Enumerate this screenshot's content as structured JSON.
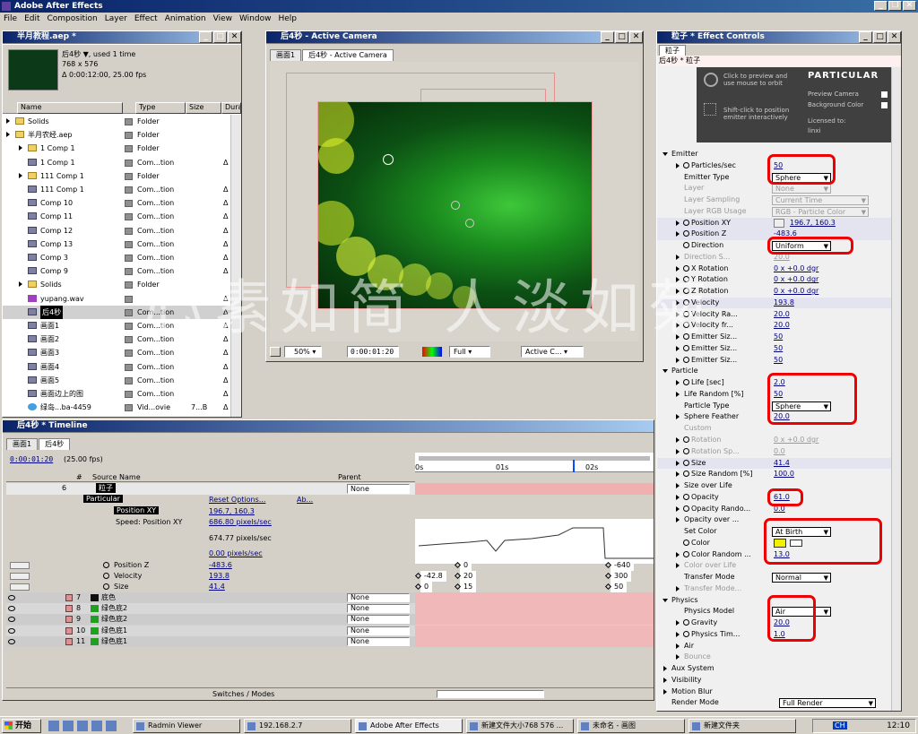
{
  "app": {
    "title": "Adobe After Effects",
    "menu": [
      "File",
      "Edit",
      "Composition",
      "Layer",
      "Effect",
      "Animation",
      "View",
      "Window",
      "Help"
    ]
  },
  "project": {
    "title": "半月教程.aep *",
    "info": {
      "name": "后4秒 ▼, used 1 time",
      "dims": "768 x 576",
      "dur": "Δ 0:00:12:00, 25.00 fps"
    },
    "columns": [
      "Name",
      "Type",
      "Size",
      "Durati"
    ],
    "items": [
      {
        "name": "Solids",
        "type": "Folder",
        "dur": "",
        "indent": 0,
        "icon": "folder",
        "sel": false
      },
      {
        "name": "半月农经.aep",
        "type": "Folder",
        "dur": "",
        "indent": 0,
        "icon": "folder",
        "sel": false
      },
      {
        "name": "1 Comp 1",
        "type": "Folder",
        "dur": "",
        "indent": 1,
        "icon": "folder",
        "sel": false
      },
      {
        "name": "1 Comp 1",
        "type": "Com...tion",
        "dur": "Δ 0",
        "indent": 1,
        "icon": "comp",
        "sel": false
      },
      {
        "name": "111 Comp 1",
        "type": "Folder",
        "dur": "",
        "indent": 1,
        "icon": "folder",
        "sel": false
      },
      {
        "name": "111 Comp 1",
        "type": "Com...tion",
        "dur": "Δ 0",
        "indent": 1,
        "icon": "comp",
        "sel": false
      },
      {
        "name": "Comp 10",
        "type": "Com...tion",
        "dur": "Δ 0",
        "indent": 1,
        "icon": "comp",
        "sel": false
      },
      {
        "name": "Comp 11",
        "type": "Com...tion",
        "dur": "Δ 0",
        "indent": 1,
        "icon": "comp",
        "sel": false
      },
      {
        "name": "Comp 12",
        "type": "Com...tion",
        "dur": "Δ 0",
        "indent": 1,
        "icon": "comp",
        "sel": false
      },
      {
        "name": "Comp 13",
        "type": "Com...tion",
        "dur": "Δ 0",
        "indent": 1,
        "icon": "comp",
        "sel": false
      },
      {
        "name": "Comp 3",
        "type": "Com...tion",
        "dur": "Δ 0",
        "indent": 1,
        "icon": "comp",
        "sel": false
      },
      {
        "name": "Comp 9",
        "type": "Com...tion",
        "dur": "Δ 0",
        "indent": 1,
        "icon": "comp",
        "sel": false
      },
      {
        "name": "Solids",
        "type": "Folder",
        "dur": "",
        "indent": 1,
        "icon": "folder",
        "sel": false
      },
      {
        "name": "yupang.wav",
        "type": "",
        "dur": "Δ 0",
        "indent": 1,
        "icon": "audio",
        "sel": false
      },
      {
        "name": "后4秒",
        "type": "Com...tion",
        "dur": "Δ 0",
        "indent": 1,
        "icon": "comp",
        "sel": true
      },
      {
        "name": "画面1",
        "type": "Com...tion",
        "dur": "Δ 0",
        "indent": 1,
        "icon": "comp",
        "sel": false
      },
      {
        "name": "画面2",
        "type": "Com...tion",
        "dur": "Δ 0",
        "indent": 1,
        "icon": "comp",
        "sel": false
      },
      {
        "name": "画面3",
        "type": "Com...tion",
        "dur": "Δ 0",
        "indent": 1,
        "icon": "comp",
        "sel": false
      },
      {
        "name": "画面4",
        "type": "Com...tion",
        "dur": "Δ 0",
        "indent": 1,
        "icon": "comp",
        "sel": false
      },
      {
        "name": "画面5",
        "type": "Com...tion",
        "dur": "Δ 0",
        "indent": 1,
        "icon": "comp",
        "sel": false
      },
      {
        "name": "画面边上的图",
        "type": "Com...tion",
        "dur": "Δ 0",
        "indent": 1,
        "icon": "comp",
        "sel": false
      },
      {
        "name": "绿岛...ba-4459",
        "type": "Vid...ovie",
        "size": "7...B",
        "dur": "Δ 0",
        "indent": 1,
        "icon": "video",
        "sel": false
      }
    ]
  },
  "viewer": {
    "title": "后4秒 - Active Camera",
    "tabs": [
      "画面1",
      "后4秒 - Active Camera"
    ],
    "zoom": "50%",
    "time": "0:00:01:20",
    "res": "Full",
    "view": "Active C..."
  },
  "effect": {
    "title": "粒子 * Effect Controls",
    "tab": "粒子",
    "layer": "后4秒 * 粒子",
    "banner": {
      "hint1": "Click to preview and use mouse to orbit",
      "hint2": "Shift-click to position emitter interactively",
      "logo": "PARTICULAR",
      "preview": "Preview Camera",
      "bg": "Background Color",
      "licensed": "Licensed to:",
      "user": "linxi"
    },
    "rows": [
      {
        "label": "Emitter",
        "lvl": 0,
        "tw": "open"
      },
      {
        "label": "Particles/sec",
        "lvl": 1,
        "tw": "closed",
        "sw": true,
        "value": "50",
        "kind": "val"
      },
      {
        "label": "Emitter Type",
        "lvl": 1,
        "value": "Sphere",
        "kind": "dd"
      },
      {
        "label": "Layer",
        "lvl": 1,
        "value": "None",
        "kind": "dd",
        "dis": true
      },
      {
        "label": "Layer Sampling",
        "lvl": 1,
        "value": "Current Time",
        "kind": "dd",
        "dis": true
      },
      {
        "label": "Layer RGB Usage",
        "lvl": 1,
        "value": "RGB - Particle Color",
        "kind": "dd",
        "dis": true
      },
      {
        "label": "Position XY",
        "lvl": 1,
        "tw": "closed",
        "sw": true,
        "value": "196.7, 160.3",
        "kind": "pt",
        "hl": true
      },
      {
        "label": "Position Z",
        "lvl": 1,
        "tw": "closed",
        "sw": true,
        "value": "-483.6",
        "kind": "val",
        "hl": true
      },
      {
        "label": "Direction",
        "lvl": 1,
        "sw": true,
        "value": "Uniform",
        "kind": "dd"
      },
      {
        "label": "Direction S...",
        "lvl": 1,
        "tw": "closed",
        "value": "20.0",
        "kind": "val",
        "dis": true
      },
      {
        "label": "X Rotation",
        "lvl": 1,
        "tw": "closed",
        "sw": true,
        "value": "0 x +0.0 dgr",
        "kind": "val"
      },
      {
        "label": "Y Rotation",
        "lvl": 1,
        "tw": "closed",
        "sw": true,
        "value": "0 x +0.0 dgr",
        "kind": "val"
      },
      {
        "label": "Z Rotation",
        "lvl": 1,
        "tw": "closed",
        "sw": true,
        "value": "0 x +0.0 dgr",
        "kind": "val"
      },
      {
        "label": "Velocity",
        "lvl": 1,
        "tw": "closed",
        "sw": true,
        "value": "193.8",
        "kind": "val",
        "hl": true
      },
      {
        "label": "Velocity Ra...",
        "lvl": 1,
        "tw": "closed",
        "sw": true,
        "value": "20.0",
        "kind": "val"
      },
      {
        "label": "Velocity fr...",
        "lvl": 1,
        "tw": "closed",
        "sw": true,
        "value": "20.0",
        "kind": "val"
      },
      {
        "label": "Emitter Siz...",
        "lvl": 1,
        "tw": "closed",
        "sw": true,
        "value": "50",
        "kind": "val"
      },
      {
        "label": "Emitter Siz...",
        "lvl": 1,
        "tw": "closed",
        "sw": true,
        "value": "50",
        "kind": "val"
      },
      {
        "label": "Emitter Siz...",
        "lvl": 1,
        "tw": "closed",
        "sw": true,
        "value": "50",
        "kind": "val"
      },
      {
        "label": "Particle",
        "lvl": 0,
        "tw": "open"
      },
      {
        "label": "Life [sec]",
        "lvl": 1,
        "tw": "closed",
        "sw": true,
        "value": "2.0",
        "kind": "val"
      },
      {
        "label": "Life Random [%]",
        "lvl": 1,
        "tw": "closed",
        "value": "50",
        "kind": "val"
      },
      {
        "label": "Particle Type",
        "lvl": 1,
        "value": "Sphere",
        "kind": "dd"
      },
      {
        "label": "Sphere Feather",
        "lvl": 1,
        "tw": "closed",
        "value": "20.0",
        "kind": "val"
      },
      {
        "label": "Custom",
        "lvl": 1,
        "kind": "none",
        "dis": true
      },
      {
        "label": "Rotation",
        "lvl": 1,
        "tw": "closed",
        "sw": true,
        "value": "0 x +0.0 dgr",
        "kind": "val",
        "dis": true
      },
      {
        "label": "Rotation Sp...",
        "lvl": 1,
        "tw": "closed",
        "sw": true,
        "value": "0.0",
        "kind": "val",
        "dis": true
      },
      {
        "label": "Size",
        "lvl": 1,
        "tw": "closed",
        "sw": true,
        "value": "41.4",
        "kind": "val",
        "hl": true
      },
      {
        "label": "Size Random [%]",
        "lvl": 1,
        "tw": "closed",
        "sw": true,
        "value": "100.0",
        "kind": "val"
      },
      {
        "label": "Size over Life",
        "lvl": 1,
        "tw": "closed",
        "kind": "none"
      },
      {
        "label": "Opacity",
        "lvl": 1,
        "tw": "closed",
        "sw": true,
        "value": "61.0",
        "kind": "val"
      },
      {
        "label": "Opacity Rando...",
        "lvl": 1,
        "tw": "closed",
        "sw": true,
        "value": "0.0",
        "kind": "val"
      },
      {
        "label": "Opacity over ...",
        "lvl": 1,
        "tw": "closed",
        "kind": "none"
      },
      {
        "label": "Set Color",
        "lvl": 1,
        "value": "At Birth",
        "kind": "dd"
      },
      {
        "label": "Color",
        "lvl": 1,
        "sw": true,
        "kind": "color",
        "color": "#f0f000"
      },
      {
        "label": "Color Random ...",
        "lvl": 1,
        "tw": "closed",
        "sw": true,
        "value": "13.0",
        "kind": "val"
      },
      {
        "label": "Color over Life",
        "lvl": 1,
        "tw": "closed",
        "kind": "none",
        "dis": true
      },
      {
        "label": "Transfer Mode",
        "lvl": 1,
        "value": "Normal",
        "kind": "dd"
      },
      {
        "label": "Transfer Mode...",
        "lvl": 1,
        "tw": "closed",
        "kind": "none",
        "dis": true
      },
      {
        "label": "Physics",
        "lvl": 0,
        "tw": "open"
      },
      {
        "label": "Physics Model",
        "lvl": 1,
        "value": "Air",
        "kind": "dd"
      },
      {
        "label": "Gravity",
        "lvl": 1,
        "tw": "closed",
        "sw": true,
        "value": "20.0",
        "kind": "val"
      },
      {
        "label": "Physics Tim...",
        "lvl": 1,
        "tw": "closed",
        "sw": true,
        "value": "1.0",
        "kind": "val"
      },
      {
        "label": "Air",
        "lvl": 1,
        "tw": "closed",
        "kind": "none"
      },
      {
        "label": "Bounce",
        "lvl": 1,
        "tw": "closed",
        "kind": "none",
        "dis": true
      },
      {
        "label": "Aux System",
        "lvl": 0,
        "tw": "closed"
      },
      {
        "label": "Visibility",
        "lvl": 0,
        "tw": "closed"
      },
      {
        "label": "Motion Blur",
        "lvl": 0,
        "tw": "closed"
      },
      {
        "label": "Render Mode",
        "lvl": 0,
        "value": "Full Render",
        "kind": "dd"
      }
    ]
  },
  "timeline": {
    "title": "后4秒 * Timeline",
    "tabs": [
      "画面1",
      "后4秒"
    ],
    "time": "0:00:01:20",
    "fps": "(25.00 fps)",
    "colhdr": {
      "num": "#",
      "src": "Source Name",
      "parent": "Parent"
    },
    "ruler": [
      "0s",
      "01s",
      "02s"
    ],
    "layer6": {
      "num": "6",
      "name": "粒子",
      "parent": "None"
    },
    "particular": "Particular",
    "reset": "Reset Options...",
    "about": "Ab...",
    "posxy": {
      "label": "Position XY",
      "value": "196.7, 160.3"
    },
    "speed": {
      "label": "Speed: Position XY",
      "v1": "686.80 pixels/sec",
      "v2": "674.77 pixels/sec",
      "v3": "0.00 pixels/sec"
    },
    "props": [
      {
        "label": "Position Z",
        "value": "-483.6",
        "k1": "0",
        "k2": "-640"
      },
      {
        "label": "Velocity",
        "value": "193.8",
        "k0": "-42.8",
        "k1": "20",
        "k2": "300"
      },
      {
        "label": "Size",
        "value": "41.4",
        "k0": "0",
        "k1": "15",
        "k2": "50"
      }
    ],
    "layers": [
      {
        "num": "7",
        "name": "底色",
        "color": "#101010",
        "parent": "None"
      },
      {
        "num": "8",
        "name": "绿色底2",
        "color": "#20a020",
        "parent": "None"
      },
      {
        "num": "9",
        "name": "绿色底2",
        "color": "#20a020",
        "parent": "None"
      },
      {
        "num": "10",
        "name": "绿色底1",
        "color": "#20a020",
        "parent": "None"
      },
      {
        "num": "11",
        "name": "绿色底1",
        "color": "#20a020",
        "parent": "None"
      }
    ],
    "switches": "Switches / Modes"
  },
  "watermark": "心素如简 人淡如菊",
  "taskbar": {
    "start": "开始",
    "items": [
      "Radmin Viewer",
      "192.168.2.7",
      "Adobe After Effects",
      "新建文件大小768 576 ...",
      "未命名 - 画图",
      "新建文件夹"
    ],
    "clock": "12:10",
    "lang": "CH"
  }
}
